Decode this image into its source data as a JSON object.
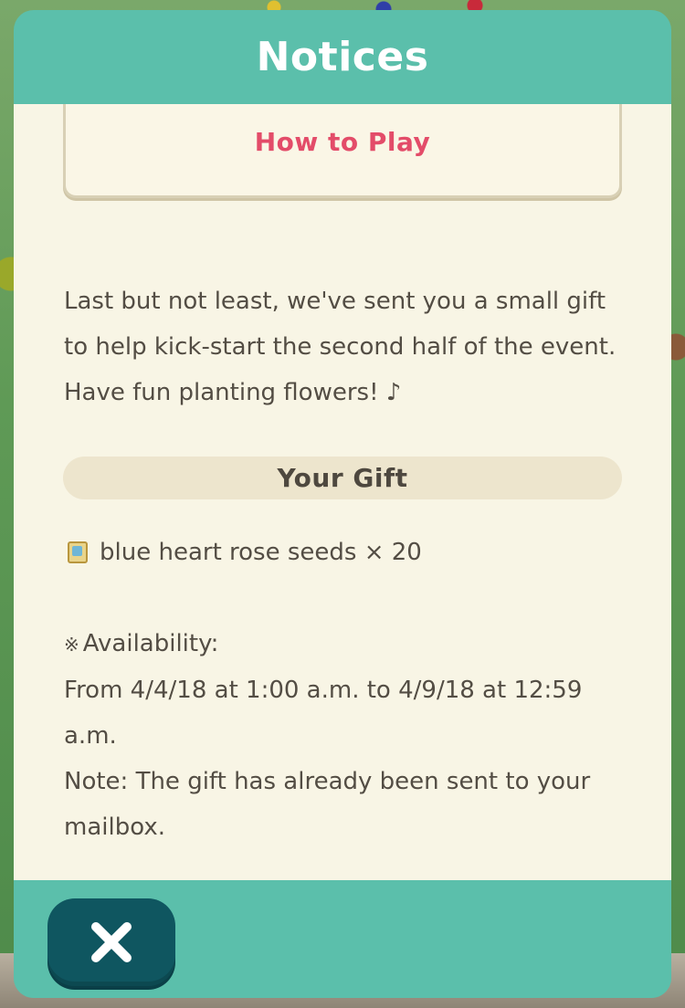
{
  "panel": {
    "title": "Notices"
  },
  "notice": {
    "howto_label": "How to Play",
    "paragraph": "Last but not least, we've sent you a small gift to help kick-start the second half of the event. Have fun planting flowers! ♪",
    "gift_header": "Your Gift",
    "gift_item": "blue heart rose seeds × 20",
    "availability_label": "Availability:",
    "availability_mark": "※",
    "availability_dates": "From 4/4/18 at 1:00 a.m. to 4/9/18 at 12:59 a.m.",
    "note": "Note: The gift has already been sent to your mailbox."
  },
  "footer": {
    "close_icon": "close-icon"
  },
  "colors": {
    "panel_teal": "#5bbfab",
    "content_cream": "#f8f5e5",
    "accent_pink": "#e34c69",
    "close_button": "#0f5660"
  }
}
